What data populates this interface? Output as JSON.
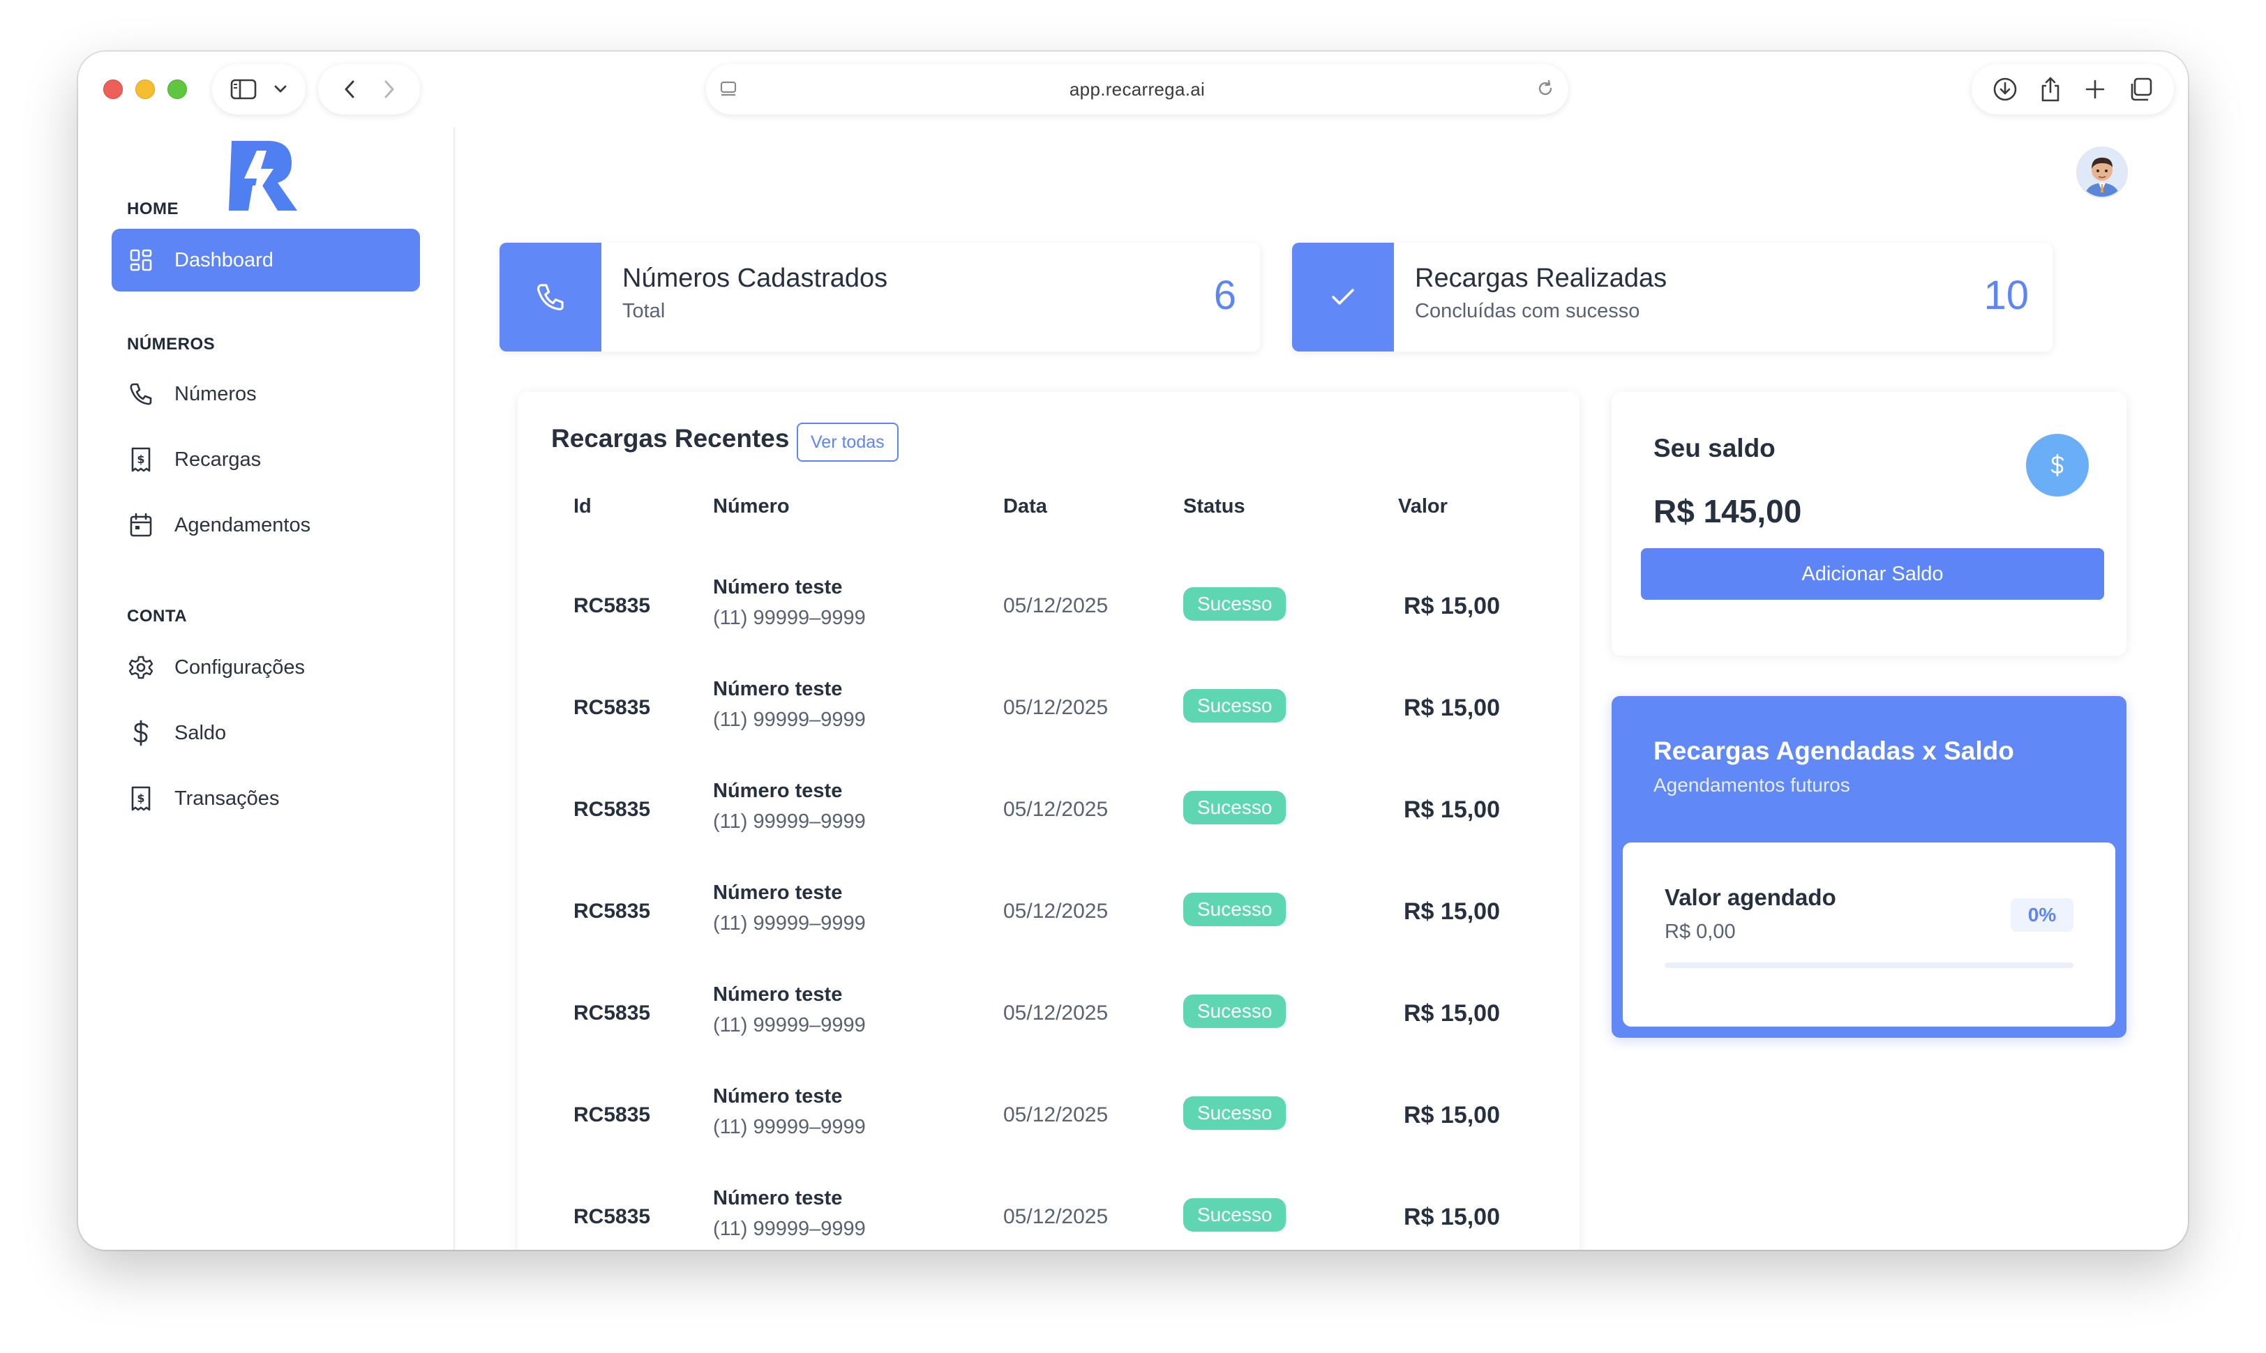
{
  "browser": {
    "url": "app.recarrega.ai"
  },
  "sidebar": {
    "sections": [
      {
        "label": "HOME"
      },
      {
        "label": "NÚMEROS"
      },
      {
        "label": "CONTA"
      }
    ],
    "items": [
      {
        "label": "Dashboard",
        "icon": "dashboard-icon",
        "active": true
      },
      {
        "label": "Números",
        "icon": "phone-icon"
      },
      {
        "label": "Recargas",
        "icon": "receipt-icon"
      },
      {
        "label": "Agendamentos",
        "icon": "calendar-icon"
      },
      {
        "label": "Configurações",
        "icon": "gear-icon"
      },
      {
        "label": "Saldo",
        "icon": "dollar-icon"
      },
      {
        "label": "Transações",
        "icon": "receipt-icon"
      }
    ]
  },
  "stats": [
    {
      "title": "Números Cadastrados",
      "subtitle": "Total",
      "value": "6",
      "icon": "phone-icon"
    },
    {
      "title": "Recargas Realizadas",
      "subtitle": "Concluídas com sucesso",
      "value": "10",
      "icon": "check-icon"
    }
  ],
  "recent": {
    "title": "Recargas Recentes",
    "view_all": "Ver todas",
    "columns": [
      "Id",
      "Número",
      "Data",
      "Status",
      "Valor"
    ],
    "rows": [
      {
        "id": "RC5835",
        "name": "Número teste",
        "phone": "(11) 99999–9999",
        "date": "05/12/2025",
        "status": "Sucesso",
        "value": "R$ 15,00"
      },
      {
        "id": "RC5835",
        "name": "Número teste",
        "phone": "(11) 99999–9999",
        "date": "05/12/2025",
        "status": "Sucesso",
        "value": "R$ 15,00"
      },
      {
        "id": "RC5835",
        "name": "Número teste",
        "phone": "(11) 99999–9999",
        "date": "05/12/2025",
        "status": "Sucesso",
        "value": "R$ 15,00"
      },
      {
        "id": "RC5835",
        "name": "Número teste",
        "phone": "(11) 99999–9999",
        "date": "05/12/2025",
        "status": "Sucesso",
        "value": "R$ 15,00"
      },
      {
        "id": "RC5835",
        "name": "Número teste",
        "phone": "(11) 99999–9999",
        "date": "05/12/2025",
        "status": "Sucesso",
        "value": "R$ 15,00"
      },
      {
        "id": "RC5835",
        "name": "Número teste",
        "phone": "(11) 99999–9999",
        "date": "05/12/2025",
        "status": "Sucesso",
        "value": "R$ 15,00"
      },
      {
        "id": "RC5835",
        "name": "Número teste",
        "phone": "(11) 99999–9999",
        "date": "05/12/2025",
        "status": "Sucesso",
        "value": "R$ 15,00"
      }
    ]
  },
  "saldo": {
    "title": "Seu saldo",
    "value": "R$ 145,00",
    "button": "Adicionar Saldo",
    "icon": "dollar-icon"
  },
  "agendadas": {
    "title": "Recargas Agendadas x Saldo",
    "subtitle": "Agendamentos futuros",
    "label": "Valor agendado",
    "amount": "R$ 0,00",
    "percent_text": "0%",
    "progress": 0
  },
  "colors": {
    "accent": "#5d85f5",
    "success": "#5ed6b2",
    "saldo_icon_bg": "#6aaef7"
  }
}
